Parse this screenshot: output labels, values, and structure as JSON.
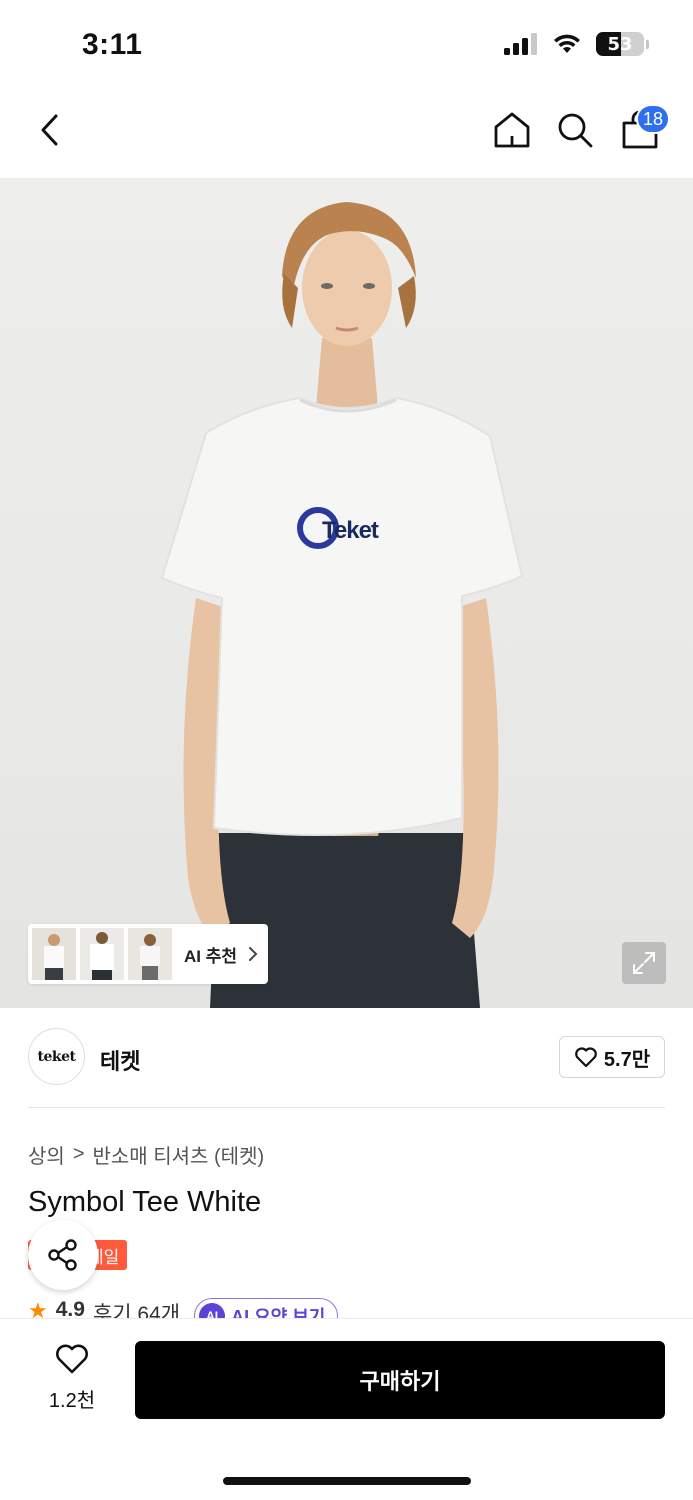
{
  "status_bar": {
    "time": "3:11",
    "battery": "53",
    "battery_level": 0.53
  },
  "nav": {
    "cart_count": "18"
  },
  "hero": {
    "print_brand": "Teket",
    "ai_recommend_label": "AI 추천"
  },
  "brand": {
    "logo_text": "teket",
    "name": "테켓",
    "likes": "5.7만"
  },
  "breadcrumb": {
    "category": "상의",
    "separator": ">",
    "subcategory": "반소매 티셔츠 (테켓)"
  },
  "product": {
    "title": "Symbol Tee White",
    "sale_tag": "세일",
    "rating": "4.9",
    "reviews": "후기 64개",
    "ai_summary_label": "AI 요약 보기",
    "ai_badge": "AI"
  },
  "bottom": {
    "wish_count": "1.2천",
    "buy_label": "구매하기"
  },
  "colors": {
    "accent": "#2f6fed",
    "sale": "#ff5a3c",
    "ai": "#5a44d6",
    "buy": "#000000"
  }
}
